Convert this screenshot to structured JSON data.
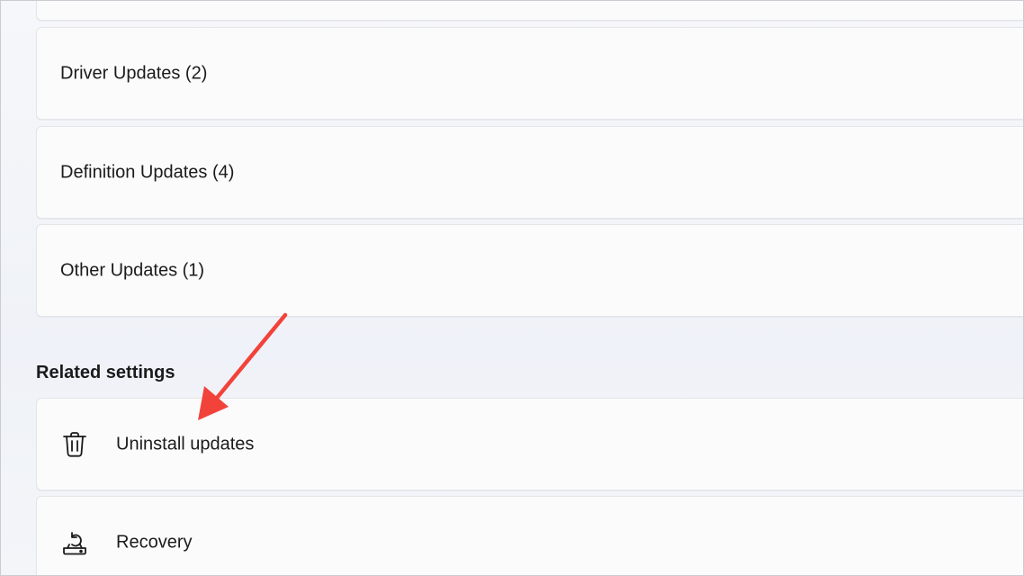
{
  "update_categories": [
    {
      "label": "Driver Updates (2)"
    },
    {
      "label": "Definition Updates (4)"
    },
    {
      "label": "Other Updates (1)"
    }
  ],
  "related_settings": {
    "title": "Related settings",
    "items": [
      {
        "label": "Uninstall updates",
        "icon": "trash-icon"
      },
      {
        "label": "Recovery",
        "icon": "recovery-icon"
      }
    ]
  },
  "annotation": {
    "arrow_color": "#f2433a"
  }
}
